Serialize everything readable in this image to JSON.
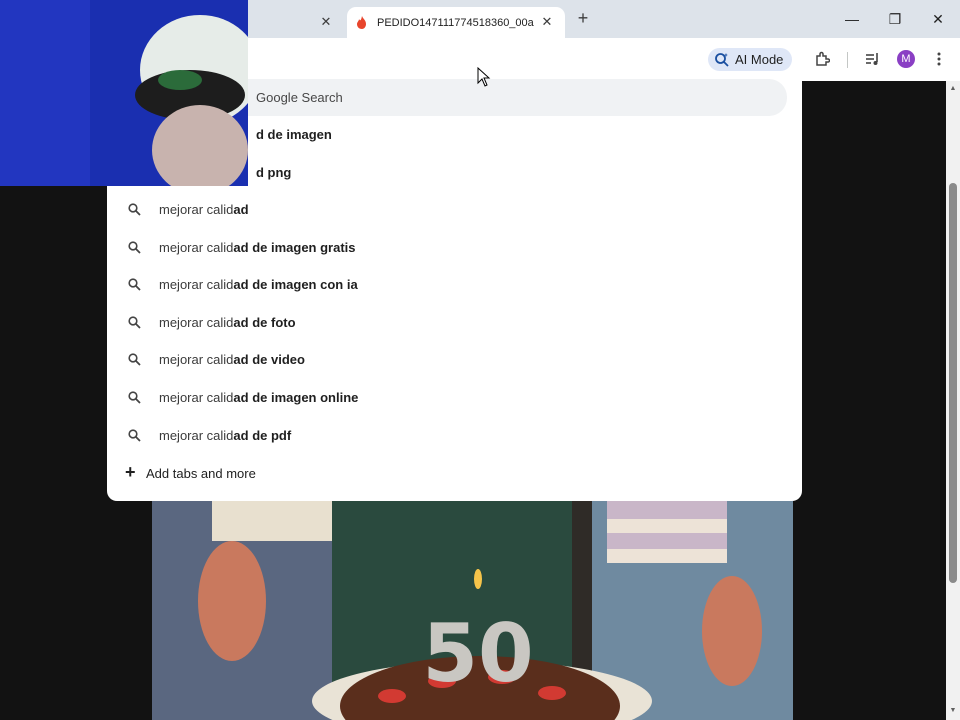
{
  "tabs": {
    "inactive": {
      "close_label": "✕"
    },
    "active": {
      "title": "PEDIDO1471117745183​60_00a",
      "close_label": "✕"
    },
    "new_tab_label": "+"
  },
  "window_controls": {
    "minimize": "—",
    "maximize": "❐",
    "close": "✕"
  },
  "toolbar": {
    "ai_mode_label": "AI Mode",
    "avatar_letter": "M"
  },
  "omnibox": {
    "placeholder": "Google Search"
  },
  "suggestions_partial": [
    {
      "typed": "",
      "completion": "d de imagen"
    },
    {
      "typed": "",
      "completion": "d png"
    }
  ],
  "suggestions": [
    {
      "typed": "mejorar calid",
      "completion": "ad"
    },
    {
      "typed": "mejorar calid",
      "completion": "ad de imagen gratis"
    },
    {
      "typed": "mejorar calid",
      "completion": "ad de imagen con ia"
    },
    {
      "typed": "mejorar calid",
      "completion": "ad de foto"
    },
    {
      "typed": "mejorar calid",
      "completion": "ad de video"
    },
    {
      "typed": "mejorar calid",
      "completion": "ad de imagen online"
    },
    {
      "typed": "mejorar calid",
      "completion": "ad de pdf"
    }
  ],
  "add_tabs": {
    "label": "Add tabs and more"
  },
  "colors": {
    "tabstrip": "#dde3ea",
    "ai_mode_chip": "#dfe7f7",
    "avatar": "#8a3fc4",
    "favicon": "#e8452c",
    "webcam_bg": "#1a2fb0"
  },
  "cake_candle_number": "50"
}
